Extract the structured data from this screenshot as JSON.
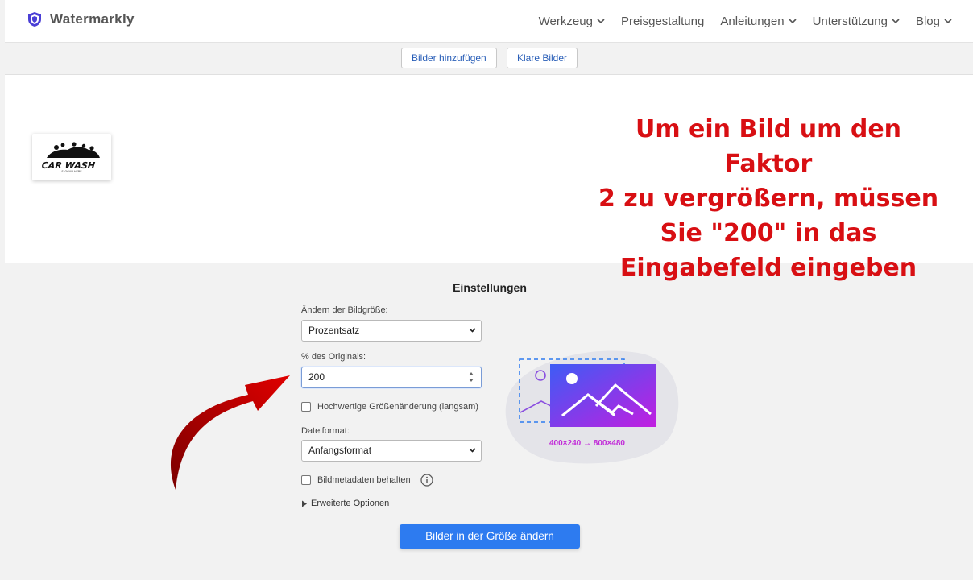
{
  "header": {
    "brand": "Watermarkly",
    "nav": [
      {
        "label": "Werkzeug",
        "dropdown": true
      },
      {
        "label": "Preisgestaltung",
        "dropdown": false
      },
      {
        "label": "Anleitungen",
        "dropdown": true
      },
      {
        "label": "Unterstützung",
        "dropdown": true
      },
      {
        "label": "Blog",
        "dropdown": true
      }
    ]
  },
  "toolbar": {
    "add_images": "Bilder hinzufügen",
    "clear_images": "Klare Bilder"
  },
  "image_area": {
    "thumbnail": {
      "logo_text": "CAR WASH",
      "logo_slogan": "SLOGAN HERE"
    }
  },
  "annotation": {
    "lines": [
      "Um ein Bild um den Faktor",
      "2 zu vergrößern, müssen",
      "Sie \"200\" in das",
      "Eingabefeld eingeben"
    ]
  },
  "settings": {
    "title": "Einstellungen",
    "resize_label": "Ändern der Bildgröße:",
    "resize_value": "Prozentsatz",
    "percent_label": "% des Originals:",
    "percent_value": "200",
    "hq_label": "Hochwertige Größenänderung (langsam)",
    "hq_checked": false,
    "format_label": "Dateiformat:",
    "format_value": "Anfangsformat",
    "metadata_label": "Bildmetadaten behalten",
    "metadata_checked": false,
    "advanced_label": "Erweiterte Optionen",
    "submit_label": "Bilder in der Größe ändern"
  },
  "illustration": {
    "dims_text": "400×240 → 800×480"
  },
  "colors": {
    "accent": "#2d7bf0",
    "annotation_red": "#d80f13",
    "brand_purple": "#4b3fd6"
  }
}
